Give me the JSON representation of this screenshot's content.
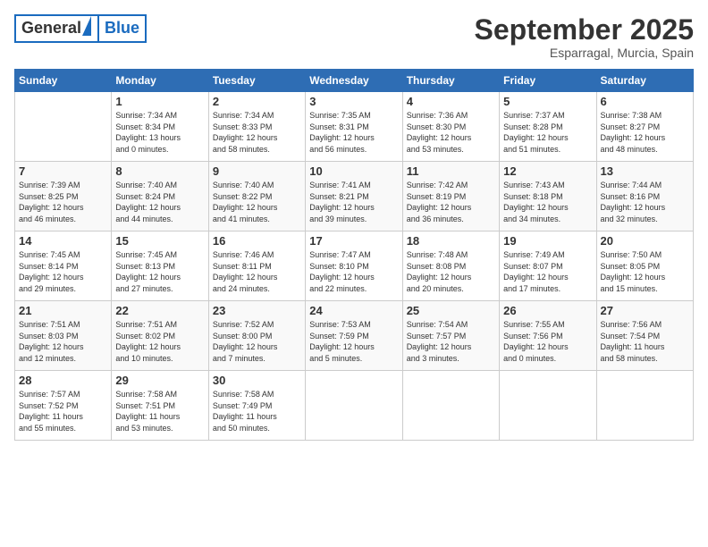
{
  "header": {
    "logo_general": "General",
    "logo_blue": "Blue",
    "month_title": "September 2025",
    "subtitle": "Esparragal, Murcia, Spain"
  },
  "days_of_week": [
    "Sunday",
    "Monday",
    "Tuesday",
    "Wednesday",
    "Thursday",
    "Friday",
    "Saturday"
  ],
  "weeks": [
    [
      {
        "day": "",
        "info": ""
      },
      {
        "day": "1",
        "info": "Sunrise: 7:34 AM\nSunset: 8:34 PM\nDaylight: 13 hours\nand 0 minutes."
      },
      {
        "day": "2",
        "info": "Sunrise: 7:34 AM\nSunset: 8:33 PM\nDaylight: 12 hours\nand 58 minutes."
      },
      {
        "day": "3",
        "info": "Sunrise: 7:35 AM\nSunset: 8:31 PM\nDaylight: 12 hours\nand 56 minutes."
      },
      {
        "day": "4",
        "info": "Sunrise: 7:36 AM\nSunset: 8:30 PM\nDaylight: 12 hours\nand 53 minutes."
      },
      {
        "day": "5",
        "info": "Sunrise: 7:37 AM\nSunset: 8:28 PM\nDaylight: 12 hours\nand 51 minutes."
      },
      {
        "day": "6",
        "info": "Sunrise: 7:38 AM\nSunset: 8:27 PM\nDaylight: 12 hours\nand 48 minutes."
      }
    ],
    [
      {
        "day": "7",
        "info": "Sunrise: 7:39 AM\nSunset: 8:25 PM\nDaylight: 12 hours\nand 46 minutes."
      },
      {
        "day": "8",
        "info": "Sunrise: 7:40 AM\nSunset: 8:24 PM\nDaylight: 12 hours\nand 44 minutes."
      },
      {
        "day": "9",
        "info": "Sunrise: 7:40 AM\nSunset: 8:22 PM\nDaylight: 12 hours\nand 41 minutes."
      },
      {
        "day": "10",
        "info": "Sunrise: 7:41 AM\nSunset: 8:21 PM\nDaylight: 12 hours\nand 39 minutes."
      },
      {
        "day": "11",
        "info": "Sunrise: 7:42 AM\nSunset: 8:19 PM\nDaylight: 12 hours\nand 36 minutes."
      },
      {
        "day": "12",
        "info": "Sunrise: 7:43 AM\nSunset: 8:18 PM\nDaylight: 12 hours\nand 34 minutes."
      },
      {
        "day": "13",
        "info": "Sunrise: 7:44 AM\nSunset: 8:16 PM\nDaylight: 12 hours\nand 32 minutes."
      }
    ],
    [
      {
        "day": "14",
        "info": "Sunrise: 7:45 AM\nSunset: 8:14 PM\nDaylight: 12 hours\nand 29 minutes."
      },
      {
        "day": "15",
        "info": "Sunrise: 7:45 AM\nSunset: 8:13 PM\nDaylight: 12 hours\nand 27 minutes."
      },
      {
        "day": "16",
        "info": "Sunrise: 7:46 AM\nSunset: 8:11 PM\nDaylight: 12 hours\nand 24 minutes."
      },
      {
        "day": "17",
        "info": "Sunrise: 7:47 AM\nSunset: 8:10 PM\nDaylight: 12 hours\nand 22 minutes."
      },
      {
        "day": "18",
        "info": "Sunrise: 7:48 AM\nSunset: 8:08 PM\nDaylight: 12 hours\nand 20 minutes."
      },
      {
        "day": "19",
        "info": "Sunrise: 7:49 AM\nSunset: 8:07 PM\nDaylight: 12 hours\nand 17 minutes."
      },
      {
        "day": "20",
        "info": "Sunrise: 7:50 AM\nSunset: 8:05 PM\nDaylight: 12 hours\nand 15 minutes."
      }
    ],
    [
      {
        "day": "21",
        "info": "Sunrise: 7:51 AM\nSunset: 8:03 PM\nDaylight: 12 hours\nand 12 minutes."
      },
      {
        "day": "22",
        "info": "Sunrise: 7:51 AM\nSunset: 8:02 PM\nDaylight: 12 hours\nand 10 minutes."
      },
      {
        "day": "23",
        "info": "Sunrise: 7:52 AM\nSunset: 8:00 PM\nDaylight: 12 hours\nand 7 minutes."
      },
      {
        "day": "24",
        "info": "Sunrise: 7:53 AM\nSunset: 7:59 PM\nDaylight: 12 hours\nand 5 minutes."
      },
      {
        "day": "25",
        "info": "Sunrise: 7:54 AM\nSunset: 7:57 PM\nDaylight: 12 hours\nand 3 minutes."
      },
      {
        "day": "26",
        "info": "Sunrise: 7:55 AM\nSunset: 7:56 PM\nDaylight: 12 hours\nand 0 minutes."
      },
      {
        "day": "27",
        "info": "Sunrise: 7:56 AM\nSunset: 7:54 PM\nDaylight: 11 hours\nand 58 minutes."
      }
    ],
    [
      {
        "day": "28",
        "info": "Sunrise: 7:57 AM\nSunset: 7:52 PM\nDaylight: 11 hours\nand 55 minutes."
      },
      {
        "day": "29",
        "info": "Sunrise: 7:58 AM\nSunset: 7:51 PM\nDaylight: 11 hours\nand 53 minutes."
      },
      {
        "day": "30",
        "info": "Sunrise: 7:58 AM\nSunset: 7:49 PM\nDaylight: 11 hours\nand 50 minutes."
      },
      {
        "day": "",
        "info": ""
      },
      {
        "day": "",
        "info": ""
      },
      {
        "day": "",
        "info": ""
      },
      {
        "day": "",
        "info": ""
      }
    ]
  ]
}
